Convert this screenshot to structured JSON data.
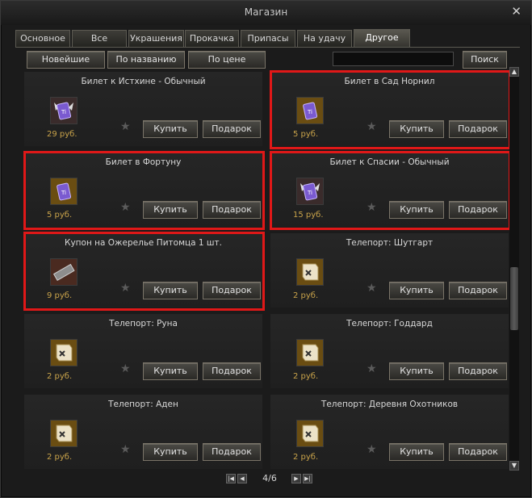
{
  "window": {
    "title": "Магазин",
    "close_glyph": "✕"
  },
  "tabs": [
    {
      "label": "Основное",
      "active": false
    },
    {
      "label": "Все",
      "active": false
    },
    {
      "label": "Украшения",
      "active": false
    },
    {
      "label": "Прокачка",
      "active": false
    },
    {
      "label": "Припасы",
      "active": false
    },
    {
      "label": "На удачу",
      "active": false
    },
    {
      "label": "Другое",
      "active": true
    }
  ],
  "sort": {
    "newest": "Новейшие",
    "by_name": "По названию",
    "by_price": "По цене"
  },
  "search": {
    "value": "",
    "button": "Поиск"
  },
  "actions": {
    "buy": "Купить",
    "gift": "Подарок"
  },
  "items": [
    {
      "name": "Билет к Истхине - Обычный",
      "price": "29 руб.",
      "icon": "ticket-purple-icon",
      "highlighted": false
    },
    {
      "name": "Билет в Сад Норнил",
      "price": "5 руб.",
      "icon": "ticket-gold-icon",
      "highlighted": true
    },
    {
      "name": "Билет в Фортуну",
      "price": "5 руб.",
      "icon": "ticket-gold-icon",
      "highlighted": true
    },
    {
      "name": "Билет к Спасии - Обычный",
      "price": "15 руб.",
      "icon": "ticket-purple-icon",
      "highlighted": true
    },
    {
      "name": "Купон на Ожерелье Питомца 1 шт.",
      "price": "9 руб.",
      "icon": "coupon-icon",
      "highlighted": true
    },
    {
      "name": "Телепорт: Шутгарт",
      "price": "2 руб.",
      "icon": "scroll-icon",
      "highlighted": false
    },
    {
      "name": "Телепорт: Руна",
      "price": "2 руб.",
      "icon": "scroll-icon",
      "highlighted": false
    },
    {
      "name": "Телепорт: Годдард",
      "price": "2 руб.",
      "icon": "scroll-icon",
      "highlighted": false
    },
    {
      "name": "Телепорт: Аден",
      "price": "2 руб.",
      "icon": "scroll-icon",
      "highlighted": false
    },
    {
      "name": "Телепорт: Деревня Охотников",
      "price": "2 руб.",
      "icon": "scroll-icon",
      "highlighted": false
    }
  ],
  "pagination": {
    "label": "4/6",
    "current": 4,
    "total": 6
  },
  "colors": {
    "highlight": "#e01818",
    "price": "#c9a34a"
  }
}
